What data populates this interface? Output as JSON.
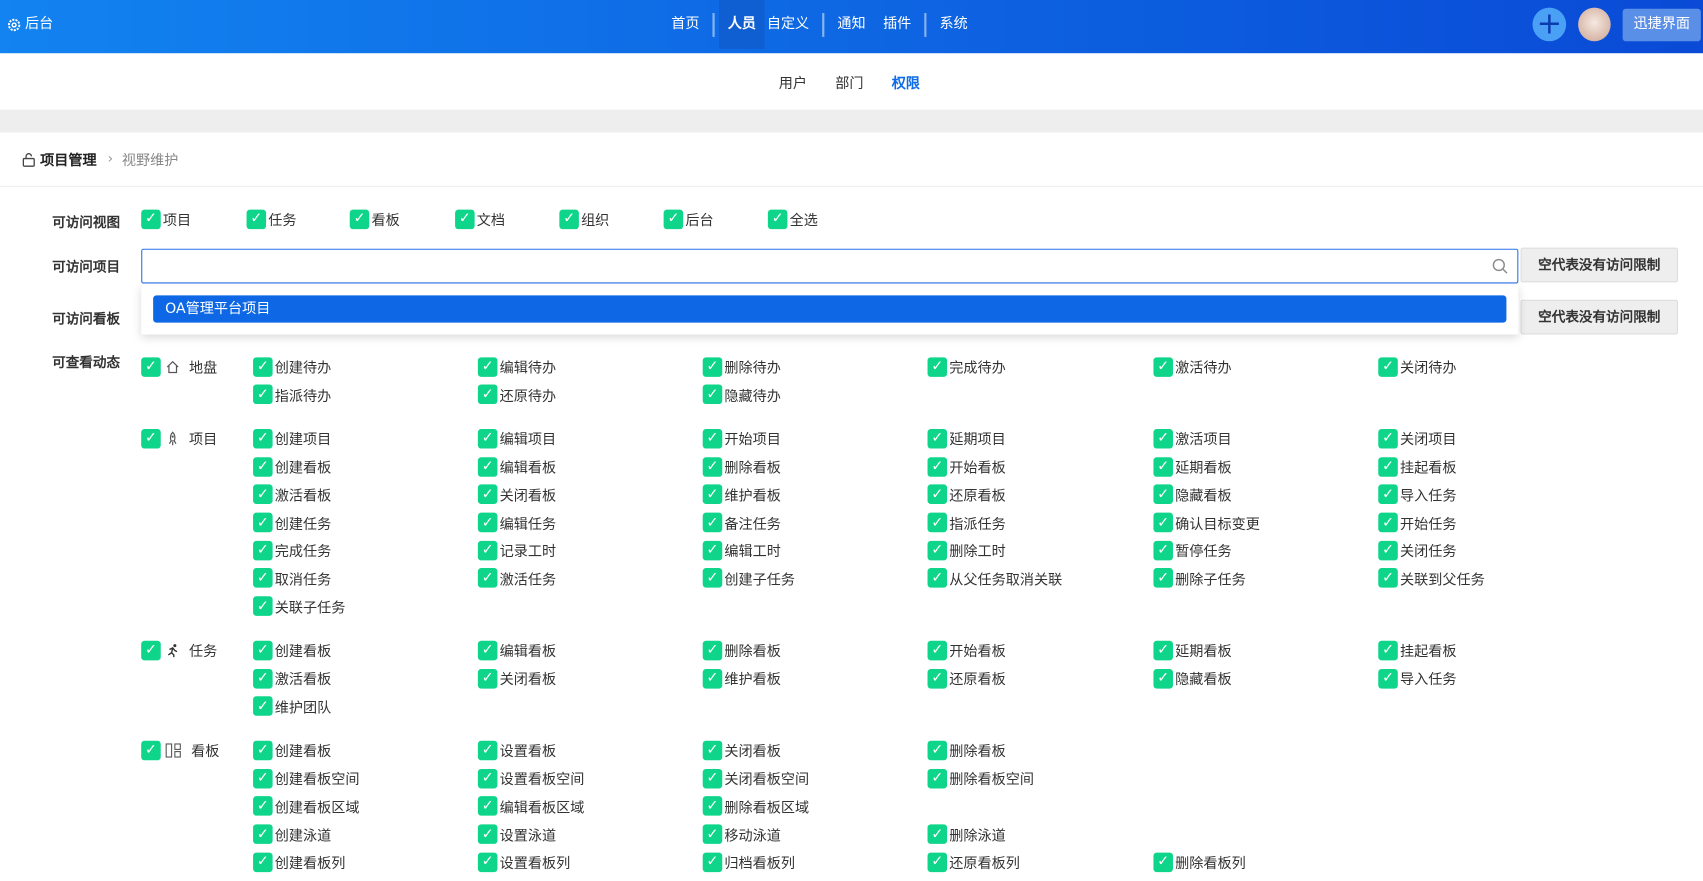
{
  "topbar": {
    "brand": "后台",
    "nav": [
      "首页",
      "人员",
      "自定义",
      "通知",
      "插件",
      "系统"
    ],
    "active": "人员",
    "quick": "迅捷界面"
  },
  "subnav": {
    "items": [
      "用户",
      "部门",
      "权限"
    ],
    "active": "权限"
  },
  "breadcrumb": {
    "root": "项目管理",
    "current": "视野维护"
  },
  "views": {
    "label": "可访问视图",
    "items": [
      "项目",
      "任务",
      "看板",
      "文档",
      "组织",
      "后台",
      "全选"
    ]
  },
  "projects": {
    "label": "可访问项目",
    "value": "",
    "button": "空代表没有访问限制",
    "option": "OA管理平台项目"
  },
  "boards": {
    "label": "可访问看板",
    "button": "空代表没有访问限制"
  },
  "dynamics": {
    "label": "可查看动态",
    "groups": [
      {
        "icon": "home-icon",
        "label": "地盘",
        "items": [
          "创建待办",
          "编辑待办",
          "删除待办",
          "完成待办",
          "激活待办",
          "关闭待办",
          "指派待办",
          "还原待办",
          "隐藏待办"
        ]
      },
      {
        "icon": "rocket-icon",
        "label": "项目",
        "items": [
          "创建项目",
          "编辑项目",
          "开始项目",
          "延期项目",
          "激活项目",
          "关闭项目",
          "创建看板",
          "编辑看板",
          "删除看板",
          "开始看板",
          "延期看板",
          "挂起看板",
          "激活看板",
          "关闭看板",
          "维护看板",
          "还原看板",
          "隐藏看板",
          "导入任务",
          "创建任务",
          "编辑任务",
          "备注任务",
          "指派任务",
          "确认目标变更",
          "开始任务",
          "完成任务",
          "记录工时",
          "编辑工时",
          "删除工时",
          "暂停任务",
          "关闭任务",
          "取消任务",
          "激活任务",
          "创建子任务",
          "从父任务取消关联",
          "删除子任务",
          "关联到父任务",
          "关联子任务"
        ]
      },
      {
        "icon": "run-icon",
        "label": "任务",
        "items": [
          "创建看板",
          "编辑看板",
          "删除看板",
          "开始看板",
          "延期看板",
          "挂起看板",
          "激活看板",
          "关闭看板",
          "维护看板",
          "还原看板",
          "隐藏看板",
          "导入任务",
          "维护团队"
        ]
      },
      {
        "icon": "kanban-icon",
        "label": "看板",
        "rows": [
          [
            "创建看板",
            "设置看板",
            "关闭看板",
            "删除看板"
          ],
          [
            "创建看板空间",
            "设置看板空间",
            "关闭看板空间",
            "删除看板空间"
          ],
          [
            "创建看板区域",
            "编辑看板区域",
            "删除看板区域"
          ],
          [
            "创建泳道",
            "设置泳道",
            "移动泳道",
            "删除泳道"
          ],
          [
            "创建看板列",
            "设置看板列",
            "归档看板列",
            "还原看板列",
            "删除看板列"
          ]
        ]
      }
    ]
  }
}
